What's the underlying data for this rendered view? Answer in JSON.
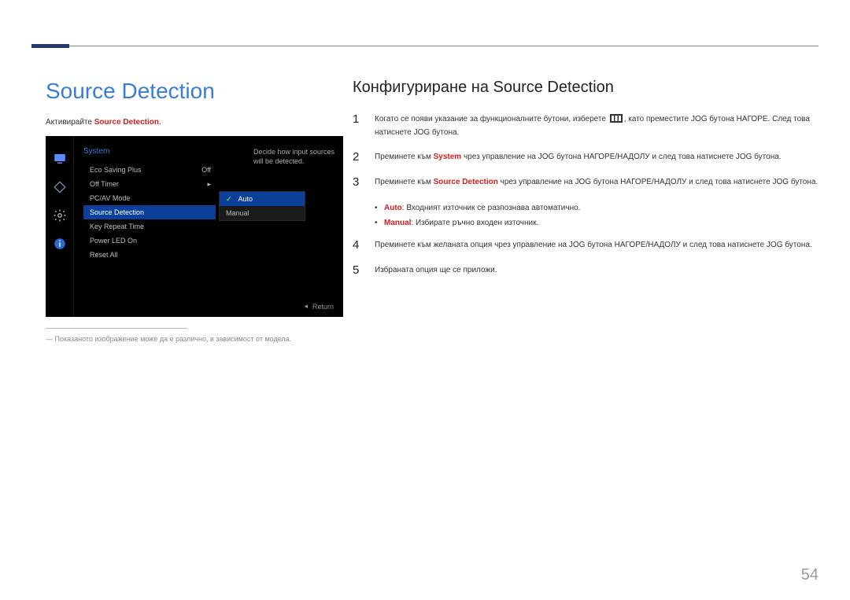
{
  "page": {
    "title": "Source Detection",
    "number": "54"
  },
  "left": {
    "activate_pre": "Активирайте ",
    "activate_bold": "Source Detection",
    "activate_post": ".",
    "caption": "― Показаното изображение може да е различно, в зависимост от модела."
  },
  "osd": {
    "title": "System",
    "items": {
      "eco": "Eco Saving Plus",
      "eco_val": "Off",
      "off_timer": "Off Timer",
      "pcav": "PC/AV Mode",
      "source": "Source Detection",
      "keyrep": "Key Repeat Time",
      "led": "Power LED On",
      "reset": "Reset All"
    },
    "sub": {
      "auto": "Auto",
      "manual": "Manual"
    },
    "help": "Decide how input sources will be detected.",
    "return": "Return"
  },
  "right": {
    "heading": "Конфигуриране на Source Detection",
    "s1a": "Когато се появи указание за функционалните бутони, изберете ",
    "s1b": ", като преместите JOG бутона НАГОРЕ. След това натиснете JOG бутона.",
    "s2a": "Преминете към ",
    "s2b": "System",
    "s2c": " чрез управление на JOG бутона НАГОРЕ/НАДОЛУ и след това натиснете JOG бутона.",
    "s3a": "Преминете към ",
    "s3b": "Source Detection",
    "s3c": " чрез управление на JOG бутона НАГОРЕ/НАДОЛУ и след това натиснете JOG бутона.",
    "b1a": "Auto",
    "b1b": ": Входният източник се разпознава автоматично.",
    "b2a": "Manual",
    "b2b": ": Избирате ръчно входен източник.",
    "s4": "Преминете към желаната опция чрез управление на JOG бутона НАГОРЕ/НАДОЛУ и след това натиснете JOG бутона.",
    "s5": "Избраната опция ще се приложи."
  }
}
